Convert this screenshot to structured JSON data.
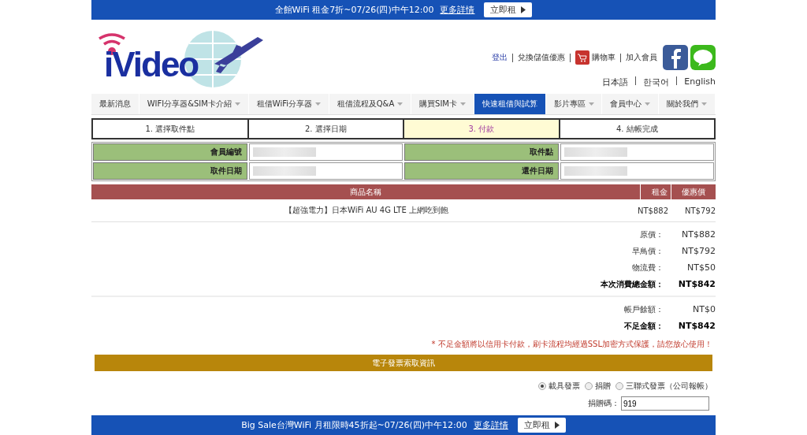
{
  "top_banner": {
    "text": "全館WiFi 租金7折~07/26(四)中午12:00",
    "link": "更多詳情",
    "button": "立即租"
  },
  "header": {
    "logo": "iVideo",
    "links": [
      {
        "text": "登出",
        "kind": "link"
      },
      {
        "text": "兌換儲值優惠",
        "kind": "text"
      },
      {
        "text": "購物車",
        "kind": "cart"
      },
      {
        "text": "加入會員",
        "kind": "text"
      }
    ],
    "languages": [
      "日本語",
      "한국어",
      "English"
    ]
  },
  "nav": [
    {
      "label": "最新消息",
      "selected": false,
      "dropdown": false
    },
    {
      "label": "WIFI分享器&SIM卡介紹",
      "selected": false,
      "dropdown": true
    },
    {
      "label": "租借WiFi分享器",
      "selected": false,
      "dropdown": true
    },
    {
      "label": "租借流程及Q&A",
      "selected": false,
      "dropdown": true
    },
    {
      "label": "購買SIM卡",
      "selected": false,
      "dropdown": true
    },
    {
      "label": "快速租借與試算",
      "selected": true,
      "dropdown": false
    },
    {
      "label": "影片專區",
      "selected": false,
      "dropdown": true
    },
    {
      "label": "會員中心",
      "selected": false,
      "dropdown": true
    },
    {
      "label": "關於我們",
      "selected": false,
      "dropdown": true
    }
  ],
  "steps": [
    {
      "label": "1. 選擇取件點",
      "selected": false
    },
    {
      "label": "2. 選擇日期",
      "selected": false
    },
    {
      "label": "3. 付款",
      "selected": true
    },
    {
      "label": "4. 結帳完成",
      "selected": false
    }
  ],
  "info": [
    {
      "label": "會員編號"
    },
    {
      "label": "取件點"
    },
    {
      "label": "取件日期"
    },
    {
      "label": "還件日期"
    }
  ],
  "table": {
    "columns": [
      "商品名稱",
      "租金",
      "優惠價"
    ],
    "rows": [
      [
        "【超強電力】日本WiFi AU 4G LTE 上網吃到飽",
        "NT$882",
        "NT$792"
      ]
    ]
  },
  "summary": [
    {
      "label": "原價：",
      "value": "NT$882",
      "bold": false
    },
    {
      "label": "早鳥價：",
      "value": "NT$792",
      "bold": false
    },
    {
      "label": "物流費：",
      "value": "NT$50",
      "bold": false
    },
    {
      "label": "本次消費總金額：",
      "value": "NT$842",
      "bold": true
    }
  ],
  "balance": [
    {
      "label": "帳戶餘額：",
      "value": "NT$0",
      "bold": false
    },
    {
      "label": "不足金額：",
      "value": "NT$842",
      "bold": true
    }
  ],
  "notice": "* 不足金額將以信用卡付款，刷卡流程均經過SSL加密方式保護，請您放心使用！",
  "invoice": {
    "title": "電子發票索取資訊",
    "options": [
      {
        "label": "載具發票",
        "selected": true
      },
      {
        "label": "捐贈",
        "selected": false
      },
      {
        "label": "三聯式發票（公司報帳）",
        "selected": false
      }
    ],
    "donation_label": "捐贈碼：",
    "donation_value": "919"
  },
  "bottom_banner": {
    "text": "Big Sale台灣WiFi 月租限時45折起~07/26(四)中午12:00",
    "link": "更多詳情",
    "button": "立即租"
  }
}
